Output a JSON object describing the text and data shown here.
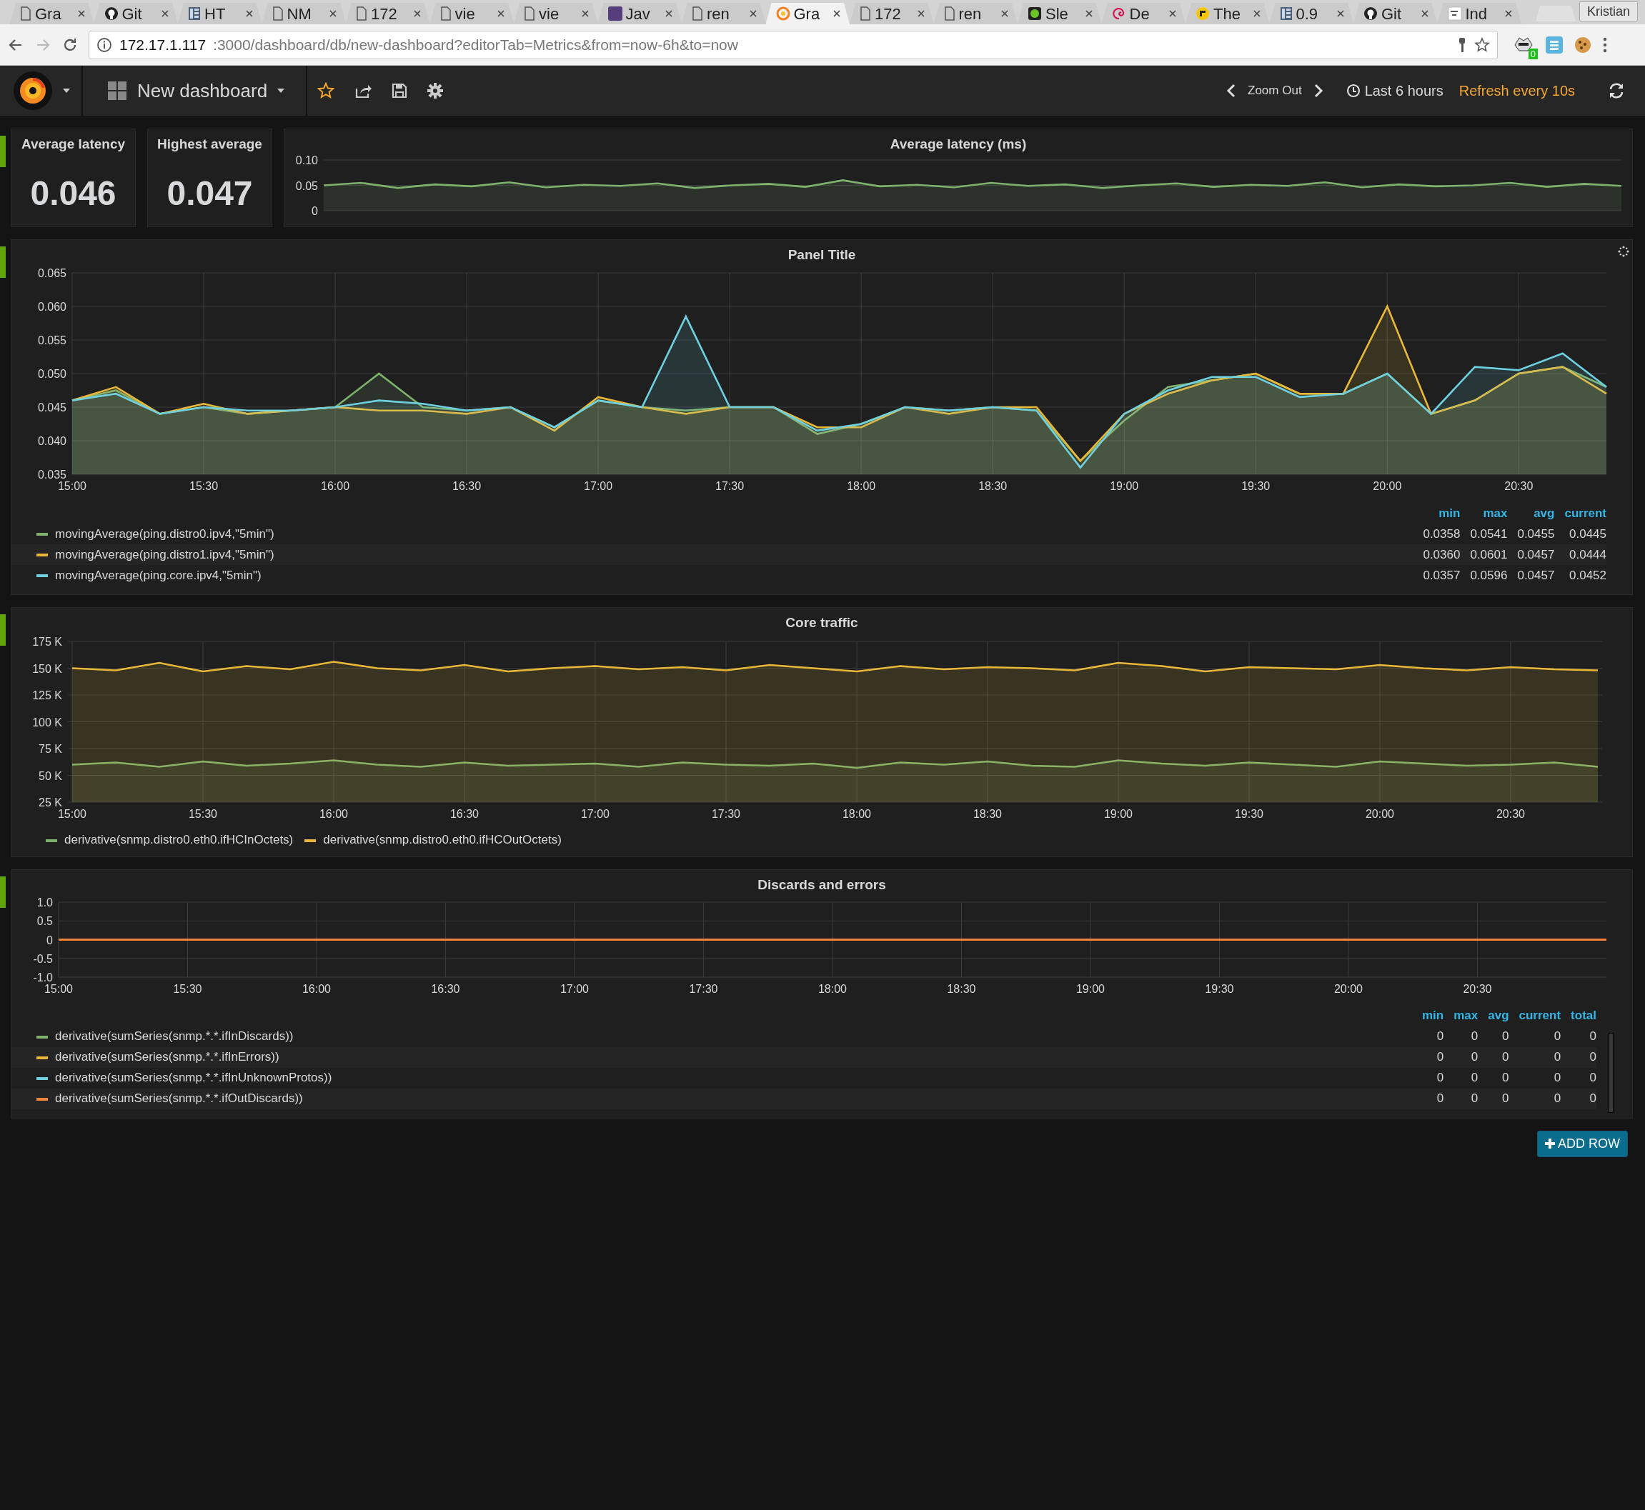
{
  "browser": {
    "tabs": [
      {
        "title": "Gra",
        "kind": "page",
        "selected": false
      },
      {
        "title": "Git",
        "kind": "github",
        "selected": false
      },
      {
        "title": "HT",
        "kind": "table",
        "selected": false
      },
      {
        "title": "NM",
        "kind": "page",
        "selected": false
      },
      {
        "title": "172",
        "kind": "page",
        "selected": false
      },
      {
        "title": "vie",
        "kind": "page",
        "selected": false
      },
      {
        "title": "vie",
        "kind": "page",
        "selected": false
      },
      {
        "title": "Jav",
        "kind": "bootstrap",
        "selected": false
      },
      {
        "title": "ren",
        "kind": "page",
        "selected": false
      },
      {
        "title": "Gra",
        "kind": "grafana",
        "selected": true
      },
      {
        "title": "172",
        "kind": "page",
        "selected": false
      },
      {
        "title": "ren",
        "kind": "page",
        "selected": false
      },
      {
        "title": "Sle",
        "kind": "dot",
        "selected": false
      },
      {
        "title": "De",
        "kind": "swirl",
        "selected": false
      },
      {
        "title": "The",
        "kind": "coin",
        "selected": false
      },
      {
        "title": "0.9",
        "kind": "table",
        "selected": false
      },
      {
        "title": "Git",
        "kind": "github",
        "selected": false
      },
      {
        "title": "Ind",
        "kind": "square",
        "selected": false
      }
    ],
    "profile": "Kristian",
    "address": {
      "host": "172.17.1.117",
      "path": ":3000/dashboard/db/new-dashboard?editorTab=Metrics&from=now-6h&to=now"
    },
    "extension_badge": "0"
  },
  "navbar": {
    "dashboard_title": "New dashboard",
    "zoom_out": "Zoom Out",
    "time_range": "Last 6 hours",
    "refresh": "Refresh every 10s"
  },
  "stats": [
    {
      "title": "Average latency",
      "value": "0.046"
    },
    {
      "title": "Highest average",
      "value": "0.047"
    }
  ],
  "sparkline_panel": {
    "title": "Average latency (ms)",
    "chart_data": {
      "type": "area",
      "categories": [
        null,
        null,
        null,
        null,
        null,
        null,
        null,
        null,
        null,
        null,
        null,
        null,
        null,
        null,
        null,
        null,
        null,
        null,
        null,
        null,
        null,
        null,
        null,
        null,
        null,
        null,
        null,
        null,
        null,
        null,
        null,
        null,
        null,
        null,
        null,
        null
      ],
      "grid": true,
      "ylim": [
        0,
        0.1
      ],
      "yticks": [
        {
          "value": 0,
          "label": "0"
        },
        {
          "value": 0.05,
          "label": "0.05"
        },
        {
          "value": 0.1,
          "label": "0.10"
        }
      ],
      "series": [
        {
          "color": "#7eb26d",
          "values": [
            0.05,
            0.055,
            0.045,
            0.052,
            0.048,
            0.056,
            0.046,
            0.051,
            0.049,
            0.054,
            0.045,
            0.05,
            0.053,
            0.047,
            0.06,
            0.048,
            0.051,
            0.046,
            0.055,
            0.049,
            0.052,
            0.045,
            0.05,
            0.054,
            0.047,
            0.051,
            0.049,
            0.056,
            0.046,
            0.052,
            0.048,
            0.05,
            0.055,
            0.047,
            0.053,
            0.049
          ]
        }
      ]
    }
  },
  "panels": [
    {
      "title": "Panel Title",
      "loading": true,
      "chart_data": {
        "type": "area",
        "categories": [
          "15:00",
          null,
          null,
          "15:30",
          null,
          null,
          "16:00",
          null,
          null,
          "16:30",
          null,
          null,
          "17:00",
          null,
          null,
          "17:30",
          null,
          null,
          "18:00",
          null,
          null,
          "18:30",
          null,
          null,
          "19:00",
          null,
          null,
          "19:30",
          null,
          null,
          "20:00",
          null,
          null,
          "20:30",
          null,
          null
        ],
        "grid": true,
        "ylim": [
          0.035,
          0.065
        ],
        "yticks": [
          {
            "value": 0.035,
            "label": "0.035"
          },
          {
            "value": 0.04,
            "label": "0.040"
          },
          {
            "value": 0.045,
            "label": "0.045"
          },
          {
            "value": 0.05,
            "label": "0.050"
          },
          {
            "value": 0.055,
            "label": "0.055"
          },
          {
            "value": 0.06,
            "label": "0.060"
          },
          {
            "value": 0.065,
            "label": "0.065"
          }
        ],
        "series": [
          {
            "name": "movingAverage(ping.distro0.ipv4,\"5min\")",
            "color": "#7eb26d",
            "values": [
              0.046,
              0.0475,
              0.044,
              0.045,
              0.044,
              0.0445,
              0.045,
              0.05,
              0.045,
              0.0445,
              0.045,
              0.042,
              0.046,
              0.045,
              0.0445,
              0.045,
              0.045,
              0.041,
              0.0425,
              0.045,
              0.0445,
              0.045,
              0.0445,
              0.037,
              0.043,
              0.048,
              0.049,
              0.05,
              0.047,
              0.047,
              0.05,
              0.044,
              0.046,
              0.05,
              0.051,
              0.048
            ]
          },
          {
            "name": "movingAverage(ping.distro1.ipv4,\"5min\")",
            "color": "#eab839",
            "values": [
              0.046,
              0.048,
              0.044,
              0.0455,
              0.044,
              0.0445,
              0.045,
              0.0445,
              0.0445,
              0.044,
              0.045,
              0.0415,
              0.0465,
              0.045,
              0.044,
              0.045,
              0.045,
              0.042,
              0.042,
              0.045,
              0.044,
              0.045,
              0.045,
              0.037,
              0.044,
              0.047,
              0.049,
              0.05,
              0.047,
              0.047,
              0.06,
              0.044,
              0.046,
              0.05,
              0.051,
              0.047
            ]
          },
          {
            "name": "movingAverage(ping.core.ipv4,\"5min\")",
            "color": "#6ed0e0",
            "values": [
              0.046,
              0.047,
              0.044,
              0.045,
              0.0445,
              0.0445,
              0.045,
              0.046,
              0.0455,
              0.0445,
              0.045,
              0.042,
              0.046,
              0.045,
              0.0585,
              0.045,
              0.045,
              0.0415,
              0.0425,
              0.045,
              0.0445,
              0.045,
              0.0445,
              0.036,
              0.044,
              0.0475,
              0.0495,
              0.0495,
              0.0465,
              0.047,
              0.05,
              0.044,
              0.051,
              0.0505,
              0.053,
              0.048
            ]
          }
        ]
      },
      "legend": {
        "kind": "table",
        "columns": [
          "min",
          "max",
          "avg",
          "current"
        ],
        "rows": [
          [
            "0.0358",
            "0.0541",
            "0.0455",
            "0.0445"
          ],
          [
            "0.0360",
            "0.0601",
            "0.0457",
            "0.0444"
          ],
          [
            "0.0357",
            "0.0596",
            "0.0457",
            "0.0452"
          ]
        ]
      }
    },
    {
      "title": "Core traffic",
      "loading": false,
      "chart_data": {
        "type": "area",
        "categories": [
          "15:00",
          null,
          null,
          "15:30",
          null,
          null,
          "16:00",
          null,
          null,
          "16:30",
          null,
          null,
          "17:00",
          null,
          null,
          "17:30",
          null,
          null,
          "18:00",
          null,
          null,
          "18:30",
          null,
          null,
          "19:00",
          null,
          null,
          "19:30",
          null,
          null,
          "20:00",
          null,
          null,
          "20:30",
          null,
          null
        ],
        "grid": true,
        "ylim": [
          25000,
          175000
        ],
        "yticks": [
          {
            "value": 25000,
            "label": "25 K"
          },
          {
            "value": 50000,
            "label": "50 K"
          },
          {
            "value": 75000,
            "label": "75 K"
          },
          {
            "value": 100000,
            "label": "100 K"
          },
          {
            "value": 125000,
            "label": "125 K"
          },
          {
            "value": 150000,
            "label": "150 K"
          },
          {
            "value": 175000,
            "label": "175 K"
          }
        ],
        "series": [
          {
            "name": "derivative(snmp.distro0.eth0.ifHCInOctets)",
            "color": "#7eb26d",
            "values": [
              60000,
              62000,
              58000,
              63000,
              59000,
              61000,
              64000,
              60000,
              58000,
              62000,
              59000,
              60000,
              61000,
              58000,
              62000,
              60000,
              59000,
              61000,
              57000,
              62000,
              60000,
              63000,
              59000,
              58000,
              64000,
              61000,
              59000,
              62000,
              60000,
              58000,
              63000,
              61000,
              59000,
              60000,
              62000,
              58000
            ]
          },
          {
            "name": "derivative(snmp.distro0.eth0.ifHCOutOctets)",
            "color": "#eab839",
            "values": [
              150000,
              148000,
              155000,
              147000,
              152000,
              149000,
              156000,
              150000,
              148000,
              153000,
              147000,
              150000,
              152000,
              149000,
              151000,
              148000,
              153000,
              150000,
              147000,
              152000,
              149000,
              151000,
              150000,
              148000,
              155000,
              152000,
              147000,
              151000,
              150000,
              149000,
              153000,
              150000,
              148000,
              151000,
              149000,
              148000
            ]
          }
        ]
      },
      "legend": {
        "kind": "inline"
      }
    },
    {
      "title": "Discards and errors",
      "loading": false,
      "chart_data": {
        "type": "line",
        "categories": [
          "15:00",
          "15:30",
          "16:00",
          "16:30",
          "17:00",
          "17:30",
          "18:00",
          "18:30",
          "19:00",
          "19:30",
          "20:00",
          "20:30",
          null
        ],
        "grid": true,
        "ylim": [
          -1,
          1
        ],
        "yticks": [
          {
            "value": -1,
            "label": "-1.0"
          },
          {
            "value": -0.5,
            "label": "-0.5"
          },
          {
            "value": 0,
            "label": "0"
          },
          {
            "value": 0.5,
            "label": "0.5"
          },
          {
            "value": 1,
            "label": "1.0"
          }
        ],
        "series": [
          {
            "name": "derivative(sumSeries(snmp.*.*.ifInDiscards))",
            "color": "#7eb26d",
            "values": [
              null,
              null,
              null,
              null,
              null,
              null,
              null,
              null,
              null,
              null,
              null,
              null,
              null
            ]
          },
          {
            "name": "derivative(sumSeries(snmp.*.*.ifInErrors))",
            "color": "#eab839",
            "values": [
              null,
              null,
              null,
              null,
              null,
              null,
              null,
              null,
              null,
              null,
              null,
              null,
              null
            ]
          },
          {
            "name": "derivative(sumSeries(snmp.*.*.ifInUnknownProtos))",
            "color": "#6ed0e0",
            "values": [
              null,
              null,
              null,
              null,
              null,
              null,
              null,
              null,
              null,
              null,
              null,
              null,
              null
            ]
          },
          {
            "name": "derivative(sumSeries(snmp.*.*.ifOutDiscards))",
            "color": "#ef843c",
            "values": [
              0,
              0,
              0,
              0,
              0,
              0,
              0,
              0,
              0,
              0,
              0,
              0,
              0
            ]
          }
        ]
      },
      "legend": {
        "kind": "table",
        "columns": [
          "min",
          "max",
          "avg",
          "current",
          "total"
        ],
        "rows": [
          [
            "0",
            "0",
            "0",
            "0",
            "0"
          ],
          [
            "0",
            "0",
            "0",
            "0",
            "0"
          ],
          [
            "0",
            "0",
            "0",
            "0",
            "0"
          ],
          [
            "0",
            "0",
            "0",
            "0",
            "0"
          ]
        ]
      }
    }
  ],
  "add_row_button": "ADD ROW"
}
